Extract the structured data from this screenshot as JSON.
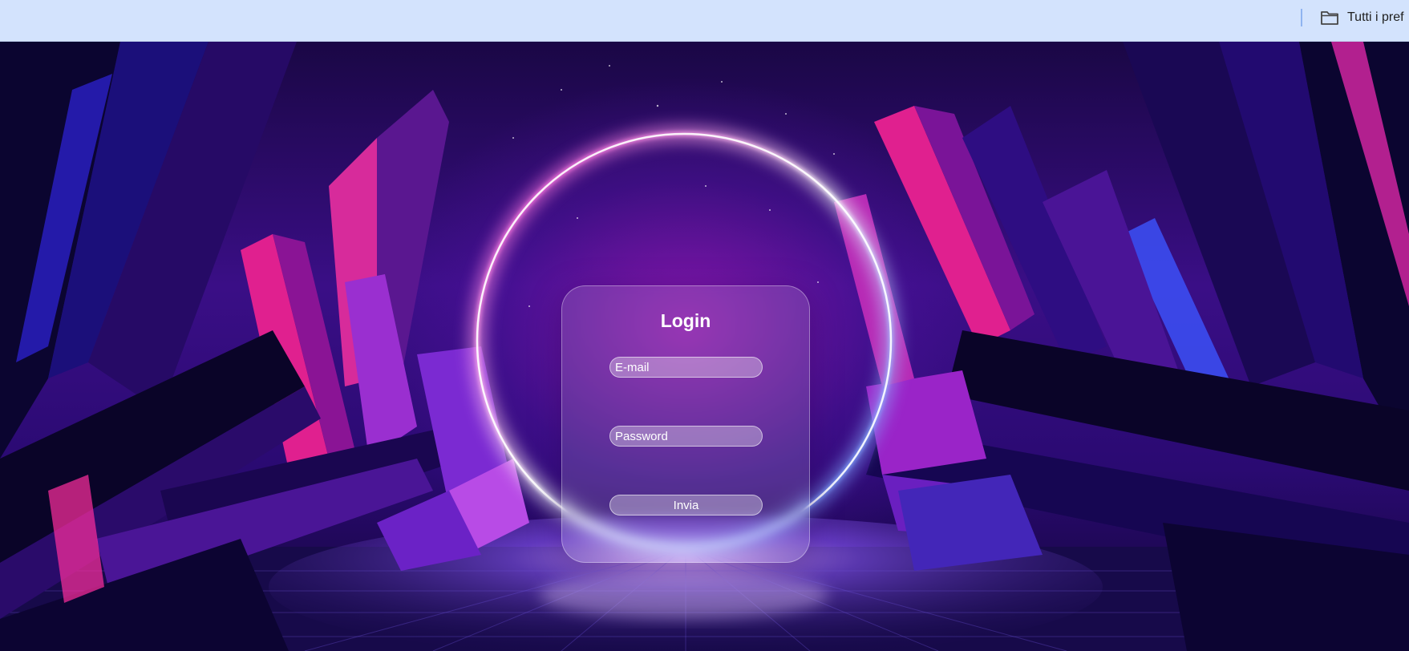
{
  "browser": {
    "bookmarks_folder_label": "Tutti i pref",
    "bookmarks_folder_icon": "folder-icon"
  },
  "login": {
    "title": "Login",
    "email_placeholder": "E-mail",
    "password_placeholder": "Password",
    "submit_label": "Invia"
  },
  "colors": {
    "bookmarks_bar": "#d3e3fd",
    "ring_glow_left": "#ff2ad0",
    "ring_glow_right": "#3f6bff"
  }
}
